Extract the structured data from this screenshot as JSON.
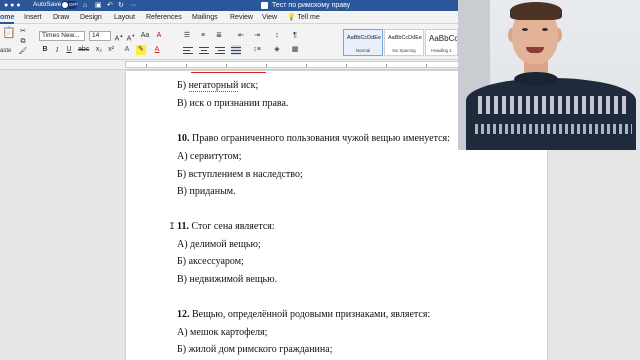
{
  "titlebar": {
    "autosave_label": "AutoSave",
    "autosave_state": "OFF",
    "doc_title": "Тест по римскому праву"
  },
  "tabs": [
    "ome",
    "Insert",
    "Draw",
    "Design",
    "Layout",
    "References",
    "Mailings",
    "Review",
    "View"
  ],
  "tell_me": "Tell me",
  "ribbon": {
    "paste_label": "aste",
    "font_name": "Times New...",
    "font_size": "14",
    "styles": [
      {
        "sample": "AaBbCcDdEe",
        "name": "Normal"
      },
      {
        "sample": "AaBbCcDdEe",
        "name": "No Spacing"
      },
      {
        "sample": "AaBbCc",
        "name": "Heading 1"
      }
    ]
  },
  "document": {
    "lines": [
      {
        "prefix": "Б) ",
        "squiggle": "негаторный",
        "text": " иск;"
      },
      {
        "text": "В) иск о признании права."
      },
      {
        "num": "10.",
        "text": " Право ограниченного пользования чужой вещью именуется:"
      },
      {
        "text": "А) сервитутом;"
      },
      {
        "text": "Б) вступлением в наследство;"
      },
      {
        "text": "В) приданым."
      },
      {
        "num": "11.",
        "text": " Стог сена является:"
      },
      {
        "text": "А) делимой вещью;"
      },
      {
        "text": "Б) аксессуаром;"
      },
      {
        "text": "В) недвижимой вещью."
      },
      {
        "num": "12.",
        "text": " Вещью, определённой родовыми признаками, является:"
      },
      {
        "text": "А) мешок картофеля;"
      },
      {
        "text": "Б) жилой дом римского гражданина;"
      }
    ]
  },
  "colors": {
    "word_blue": "#2b579a",
    "ribbon_bg": "#f3f3f3",
    "spell_red": "#dd2222"
  }
}
